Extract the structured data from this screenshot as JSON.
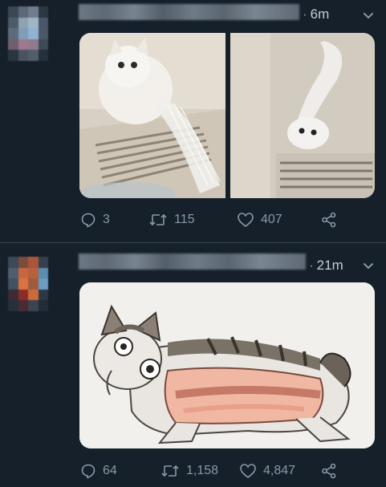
{
  "tweets": [
    {
      "time": "6m",
      "media_description": "two photos",
      "stats": {
        "replies": "3",
        "retweets": "115",
        "likes": "407"
      }
    },
    {
      "time": "21m",
      "media_description": "drawing",
      "stats": {
        "replies": "64",
        "retweets": "1,158",
        "likes": "4,847"
      }
    }
  ],
  "icons": {
    "reply": "reply-icon",
    "retweet": "retweet-icon",
    "like": "heart-icon",
    "share": "share-icon",
    "menu": "chevron-down-icon"
  },
  "colors": {
    "background": "#15202b",
    "muted_text": "#8899a6",
    "time_text": "#c5cfd8",
    "divider": "#38444d"
  }
}
